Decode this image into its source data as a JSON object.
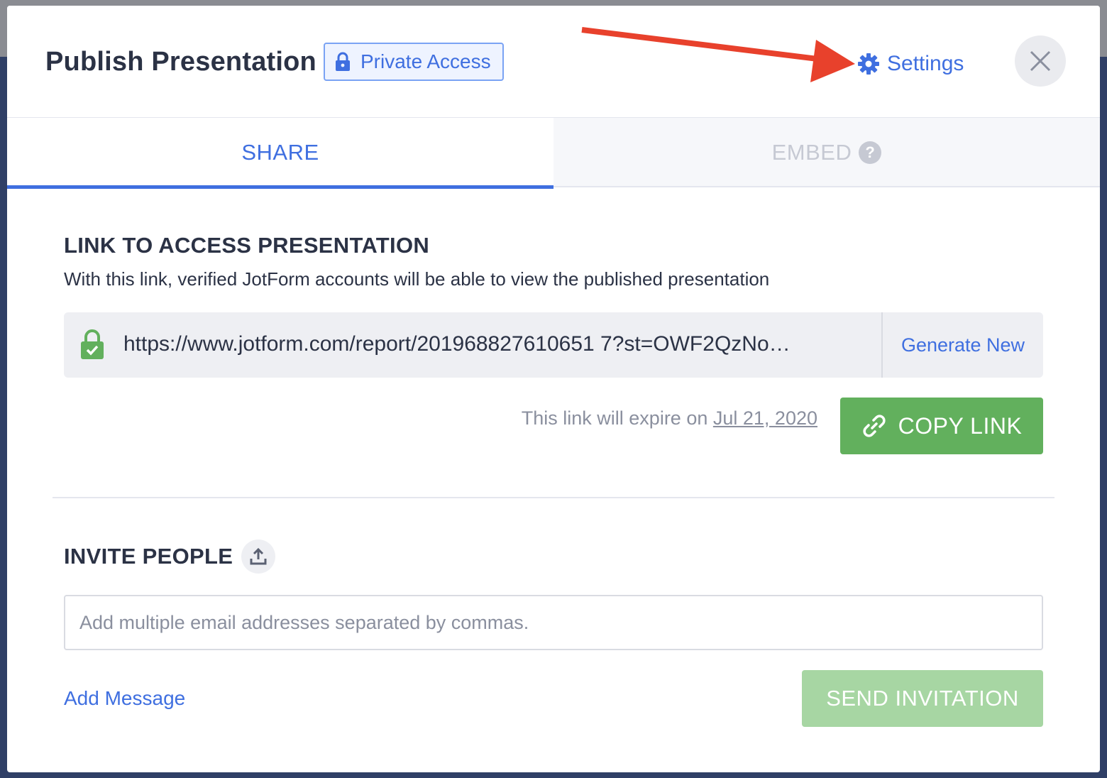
{
  "header": {
    "title": "Publish Presentation",
    "access_badge": "Private Access",
    "settings_label": "Settings"
  },
  "tabs": [
    {
      "label": "SHARE",
      "active": true
    },
    {
      "label": "EMBED",
      "active": false,
      "icon": "help-icon"
    }
  ],
  "link_section": {
    "title": "LINK TO ACCESS PRESENTATION",
    "description": "With this link, verified JotForm accounts will be able to view the published presentation",
    "url": "https://www.jotform.com/report/201968827610651 7?st=OWF2QzNo…",
    "generate_new": "Generate New",
    "expire_prefix": "This link will expire on",
    "expire_date": "Jul 21, 2020",
    "copy_button": "COPY LINK"
  },
  "invite_section": {
    "title": "INVITE PEOPLE",
    "email_placeholder": "Add multiple email addresses separated by commas.",
    "email_value": "",
    "add_message": "Add Message",
    "send_button": "SEND INVITATION"
  },
  "colors": {
    "accent": "#3f6fe0",
    "copy_green": "#62b05d",
    "send_green_disabled": "#a7d6a3",
    "annotation_arrow": "#e8412c"
  }
}
